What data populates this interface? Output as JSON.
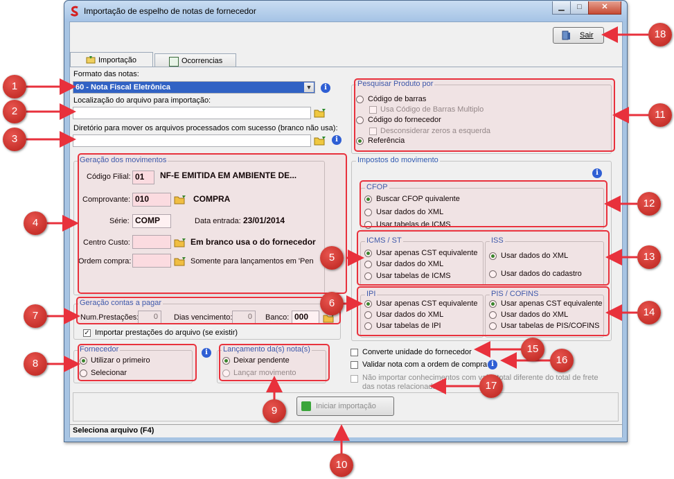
{
  "window": {
    "title": "Importação de espelho de notas de fornecedor",
    "exit_label": "Sair"
  },
  "tabs": [
    {
      "label": "Importação",
      "active": true
    },
    {
      "label": "Ocorrencias",
      "active": false
    }
  ],
  "form": {
    "format_label": "Formato das notas:",
    "format_value": "60 - Nota Fiscal Eletrônica",
    "file_location_label": "Localização do arquivo para importação:",
    "file_location_value": "",
    "move_dir_label": "Diretório para mover os arquivos processados com sucesso (branco não usa):",
    "move_dir_value": ""
  },
  "movimentos": {
    "title": "Geração dos movimentos",
    "filial_label": "Código Filial:",
    "filial_value": "01",
    "filial_desc": "NF-E EMITIDA EM AMBIENTE DE...",
    "comprovante_label": "Comprovante:",
    "comprovante_value": "010",
    "comprovante_desc": "COMPRA",
    "serie_label": "Série:",
    "serie_value": "COMP",
    "data_entrada_label": "Data entrada:",
    "data_entrada_value": "23/01/2014",
    "centro_custo_label": "Centro Custo:",
    "centro_custo_desc": "Em branco usa o do fornecedor",
    "ordem_compra_label": "Ordem compra:",
    "ordem_compra_desc": "Somente para lançamentos em 'Pendente'"
  },
  "contas": {
    "title": "Geração contas a pagar",
    "prestacoes_label": "Num.Prestações:",
    "prestacoes_value": "0",
    "dias_label": "Dias vencimento:",
    "dias_value": "0",
    "banco_label": "Banco:",
    "banco_value": "000",
    "importar_label": "Importar prestações do arquivo (se existir)"
  },
  "fornecedor": {
    "title": "Fornecedor",
    "options": [
      "Utilizar o primeiro",
      "Selecionar"
    ]
  },
  "lancamento": {
    "title": "Lançamento da(s) nota(s)",
    "options": [
      "Deixar pendente",
      "Lançar movimento"
    ]
  },
  "pesquisar": {
    "title": "Pesquisar Produto por",
    "codigo_barras": "Código de barras",
    "multiplo": "Usa Código de Barras Multiplo",
    "codigo_fornecedor": "Código do fornecedor",
    "zeros": "Desconsiderar zeros a esquerda",
    "referencia": "Referência"
  },
  "impostos": {
    "title": "Impostos do movimento",
    "cfop": {
      "title": "CFOP",
      "options": [
        "Buscar CFOP quivalente",
        "Usar dados do XML",
        "Usar tabelas de ICMS"
      ]
    },
    "icms": {
      "title": "ICMS / ST",
      "options": [
        "Usar apenas CST equivalente",
        "Usar dados do XML",
        "Usar tabelas de ICMS"
      ]
    },
    "iss": {
      "title": "ISS",
      "options": [
        "Usar dados do XML",
        "Usar dados do cadastro"
      ]
    },
    "ipi": {
      "title": "IPI",
      "options": [
        "Usar apenas CST equivalente",
        "Usar dados do XML",
        "Usar tabelas de IPI"
      ]
    },
    "pis": {
      "title": "PIS / COFINS",
      "options": [
        "Usar apenas CST equivalente",
        "Usar dados do XML",
        "Usar tabelas de PIS/COFINS"
      ]
    }
  },
  "options": {
    "converte": "Converte unidade do fornecedor",
    "validar": "Validar nota com a ordem de compra",
    "nao_importar": "Não importar conhecimentos com valor total diferente do total de frete das notas relacionadas."
  },
  "start_button": "Iniciar importação",
  "status_bar": "Seleciona arquivo (F4)",
  "callouts": [
    "1",
    "2",
    "3",
    "4",
    "5",
    "6",
    "7",
    "8",
    "9",
    "10",
    "11",
    "12",
    "13",
    "14",
    "15",
    "16",
    "17",
    "18"
  ],
  "colors": {
    "accent_red": "#e8313c",
    "group_title": "#2f59b1",
    "window_frame": "#a7c4e3"
  }
}
